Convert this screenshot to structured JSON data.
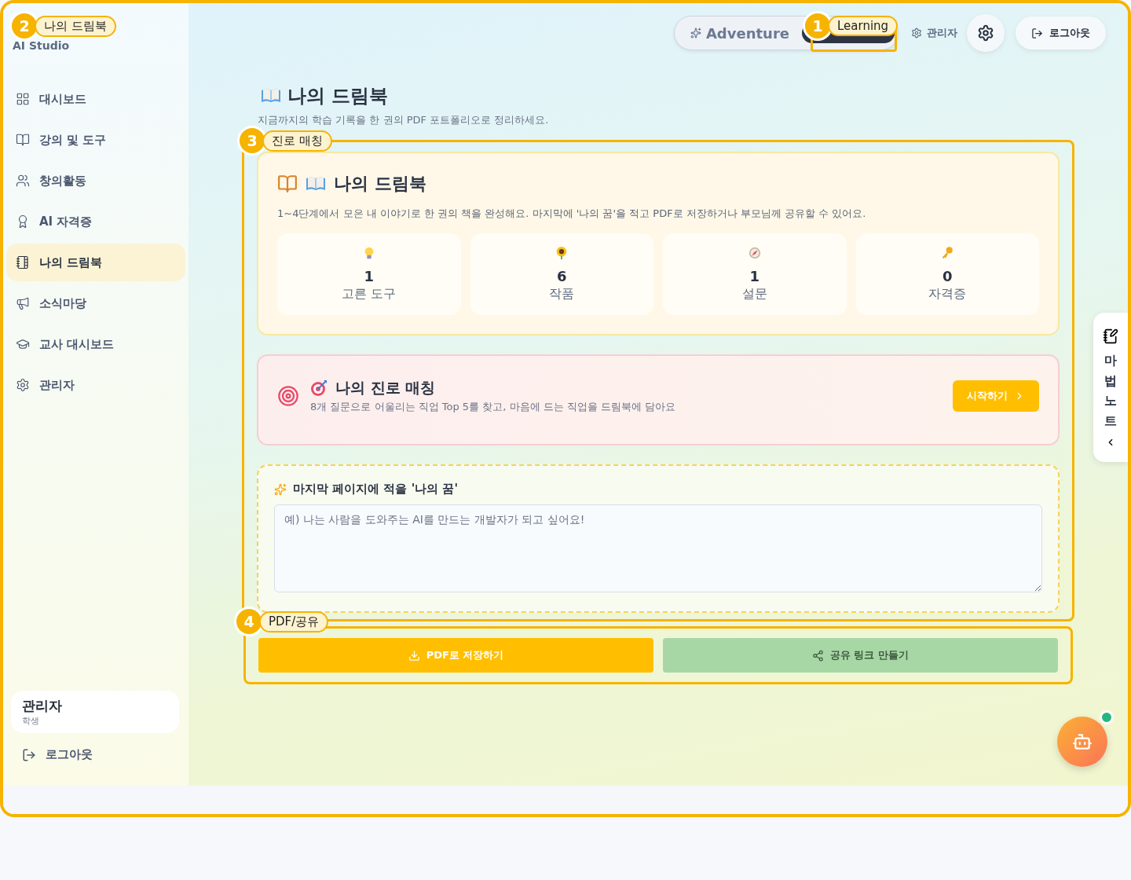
{
  "sidebar": {
    "brand_subtitle": "AI Studio",
    "items": [
      {
        "label": "대시보드",
        "selected": false
      },
      {
        "label": "강의 및 도구",
        "selected": false
      },
      {
        "label": "창의활동",
        "selected": false
      },
      {
        "label": "AI 자격증",
        "selected": false
      },
      {
        "label": "나의 드림북",
        "selected": true
      },
      {
        "label": "소식마당",
        "selected": false
      },
      {
        "label": "교사 대시보드",
        "selected": false
      },
      {
        "label": "관리자",
        "selected": false
      }
    ],
    "user": {
      "name": "관리자",
      "role": "학생"
    },
    "logout": "로그아웃"
  },
  "topbar": {
    "modes": [
      {
        "label": "Adventure",
        "selected": false
      },
      {
        "selected": true
      }
    ],
    "admin_link": "관리자",
    "logout": "로그아웃"
  },
  "page": {
    "title": "나의 드림북",
    "subtitle": "지금까지의 학습 기록을 한 권의 PDF 포트폴리오로 정리하세요."
  },
  "dreambook_card": {
    "title": "나의 드림북",
    "description": "1~4단계에서 모은 내 이야기로 한 권의 책을 완성해요. 마지막에 '나의 꿈'을 적고 PDF로 저장하거나 부모님께 공유할 수 있어요.",
    "stats": [
      {
        "value": "1",
        "label": "고른 도구"
      },
      {
        "value": "6",
        "label": "작품"
      },
      {
        "value": "1",
        "label": "설문"
      },
      {
        "value": "0",
        "label": "자격증"
      }
    ]
  },
  "career_card": {
    "title": "나의 진로 매칭",
    "description": "8개 질문으로 어울리는 직업 Top 5를 찾고, 마음에 드는 직업을 드림북에 담아요",
    "button": "시작하기"
  },
  "dream_input": {
    "label": "마지막 페이지에 적을 '나의 꿈'",
    "placeholder": "예) 나는 사람을 도와주는 AI를 만드는 개발자가 되고 싶어요!"
  },
  "actions": [
    {
      "kind": "primary",
      "label": "PDF로 저장하기"
    },
    {
      "kind": "share",
      "label": "공유 링크 만들기"
    }
  ],
  "side_tab": {
    "label": "마법노트"
  },
  "chatbot": {
    "online": true
  },
  "annotations": [
    {
      "number": "2",
      "label": "나의 드림북"
    },
    {
      "number": "1",
      "label": "Learning"
    },
    {
      "number": "3",
      "label": "진로 매칭"
    },
    {
      "number": "4",
      "label": "PDF/공유"
    }
  ]
}
